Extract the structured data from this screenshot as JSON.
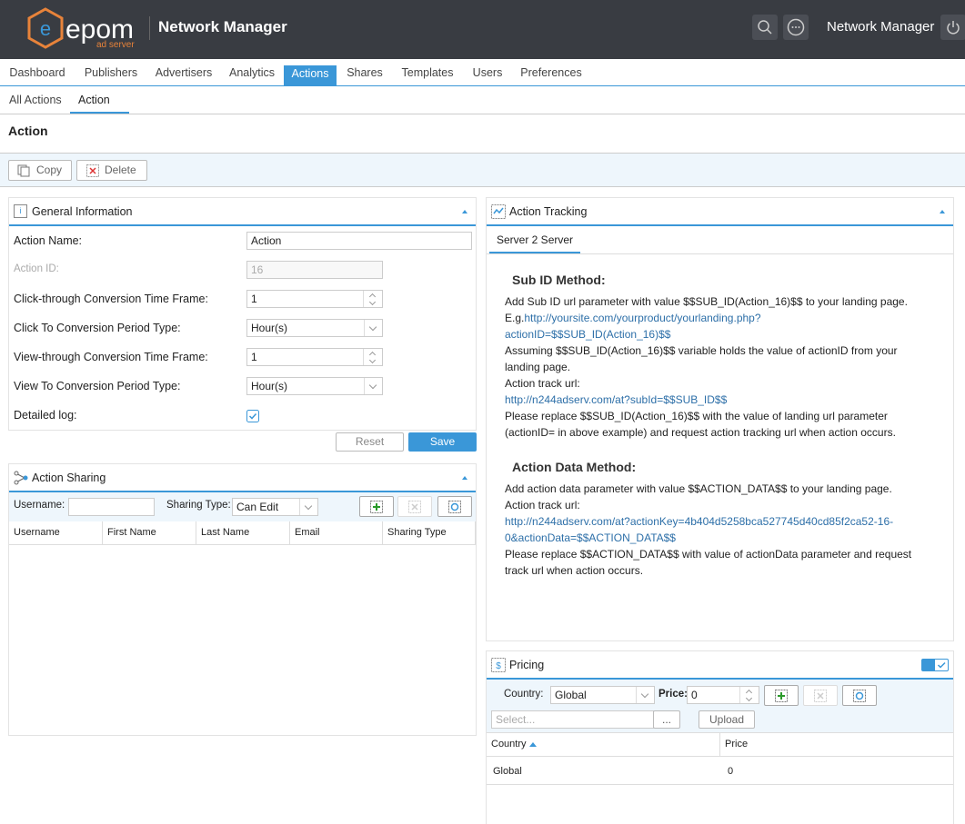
{
  "header": {
    "logo_main": "epom",
    "logo_sub": "ad server",
    "brand": "Network Manager",
    "user": "Network Manager"
  },
  "nav": {
    "items": [
      "Dashboard",
      "Publishers",
      "Advertisers",
      "Analytics",
      "Actions",
      "Shares",
      "Templates",
      "Users",
      "Preferences"
    ],
    "active": "Actions"
  },
  "subnav": {
    "items": [
      "All Actions",
      "Action"
    ],
    "active": "Action"
  },
  "page": {
    "title": "Action"
  },
  "toolbar": {
    "copy": "Copy",
    "delete": "Delete"
  },
  "general": {
    "title": "General Information",
    "fields": {
      "action_name_label": "Action Name:",
      "action_name_value": "Action",
      "action_id_label": "Action ID:",
      "action_id_value": "16",
      "ct_time_label": "Click-through Conversion Time Frame:",
      "ct_time_value": "1",
      "ct_period_label": "Click To Conversion Period Type:",
      "ct_period_value": "Hour(s)",
      "vt_time_label": "View-through Conversion Time Frame:",
      "vt_time_value": "1",
      "vt_period_label": "View To Conversion Period Type:",
      "vt_period_value": "Hour(s)",
      "detailed_log_label": "Detailed log:",
      "detailed_log_checked": true
    },
    "reset": "Reset",
    "save": "Save"
  },
  "sharing": {
    "title": "Action Sharing",
    "username_label": "Username:",
    "sharing_type_label": "Sharing Type:",
    "sharing_type_value": "Can Edit",
    "columns": [
      "Username",
      "First Name",
      "Last Name",
      "Email",
      "Sharing Type"
    ]
  },
  "tracking": {
    "title": "Action Tracking",
    "tab": "Server 2 Server",
    "subid_title": "Sub ID Method:",
    "subid_l1": "Add Sub ID url parameter with value $$SUB_ID(Action_16)$$ to your landing page.",
    "subid_eg": "E.g.",
    "subid_link1a": "http://yoursite.com/yourproduct/yourlanding.php?",
    "subid_link1b": "actionID=$$SUB_ID(Action_16)$$",
    "subid_l2": "Assuming $$SUB_ID(Action_16)$$ variable holds the value of actionID from your landing page.",
    "subid_l3": "Action track url:",
    "subid_link2": "http://n244adserv.com/at?subId=$$SUB_ID$$",
    "subid_l4": "Please replace $$SUB_ID(Action_16)$$ with the value of landing url parameter (actionID= in above example) and request action tracking url when action occurs.",
    "data_title": "Action Data Method:",
    "data_l1": "Add action data parameter with value $$ACTION_DATA$$ to your landing page.",
    "data_l2": "Action track url:",
    "data_link_a": "http://n244adserv.com/at?actionKey=4b404d5258bca527745d40cd85f2ca52-16-",
    "data_link_b": "0&actionData=$$ACTION_DATA$$",
    "data_l3": "Please replace $$ACTION_DATA$$ with value of actionData parameter and request track url when action occurs."
  },
  "pricing": {
    "title": "Pricing",
    "country_label": "Country:",
    "country_value": "Global",
    "price_label": "Price:",
    "price_value": "0",
    "select_placeholder": "Select...",
    "browse": "...",
    "upload": "Upload",
    "columns": [
      "Country",
      "Price"
    ],
    "rows": [
      {
        "country": "Global",
        "price": "0"
      }
    ]
  },
  "colors": {
    "accent": "#3a97d8",
    "topbar": "#393c42",
    "logo": "#e8833a"
  }
}
